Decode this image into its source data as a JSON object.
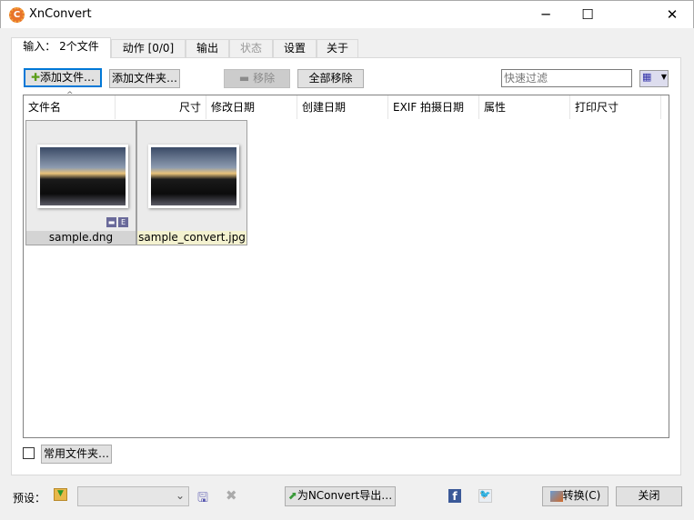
{
  "window": {
    "title": "XnConvert",
    "minimize": "─",
    "maximize": "☐",
    "close": "✕"
  },
  "tabs": [
    {
      "label": "输入： 2个文件"
    },
    {
      "label": "动作 [0/0]"
    },
    {
      "label": "输出"
    },
    {
      "label": "状态"
    },
    {
      "label": "设置"
    },
    {
      "label": "关于"
    }
  ],
  "toolbar": {
    "add_files": "添加文件…",
    "add_folder": "添加文件夹…",
    "remove": "移除",
    "remove_all": "全部移除",
    "filter_placeholder": "快速过滤"
  },
  "columns": [
    "文件名",
    "尺寸",
    "修改日期",
    "创建日期",
    "EXIF 拍摄日期",
    "属性",
    "打印尺寸"
  ],
  "files": [
    {
      "name": "sample.dng",
      "badges": [
        "▬",
        "E"
      ]
    },
    {
      "name": "sample_convert.jpg"
    }
  ],
  "bottom": {
    "favorites": "常用文件夹…",
    "preset_label": "预设：",
    "export": "为NConvert导出…",
    "convert": "转换(C)",
    "close": "关闭"
  }
}
